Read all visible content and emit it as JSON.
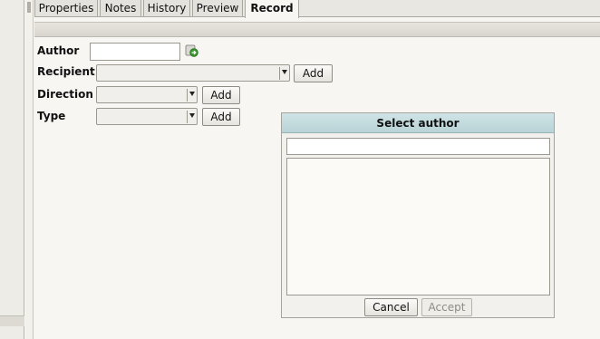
{
  "tabs": [
    {
      "label": "Properties",
      "active": false
    },
    {
      "label": "Notes",
      "active": false
    },
    {
      "label": "History",
      "active": false
    },
    {
      "label": "Preview",
      "active": false
    },
    {
      "label": "Record",
      "active": true
    }
  ],
  "form": {
    "author": {
      "label": "Author",
      "value": ""
    },
    "recipient": {
      "label": "Recipient",
      "selected": "",
      "add_label": "Add"
    },
    "direction": {
      "label": "Direction",
      "selected": "",
      "add_label": "Add"
    },
    "type": {
      "label": "Type",
      "selected": "",
      "add_label": "Add"
    }
  },
  "icons": {
    "author_go": "go-arrow-icon"
  },
  "dialog": {
    "title": "Select author",
    "search_value": "",
    "cancel_label": "Cancel",
    "accept_label": "Accept",
    "accept_enabled": false
  },
  "colors": {
    "dialog_title_bg": "#c4dcdf",
    "background": "#f7f6f2",
    "go_icon_green": "#3a9a2e"
  }
}
